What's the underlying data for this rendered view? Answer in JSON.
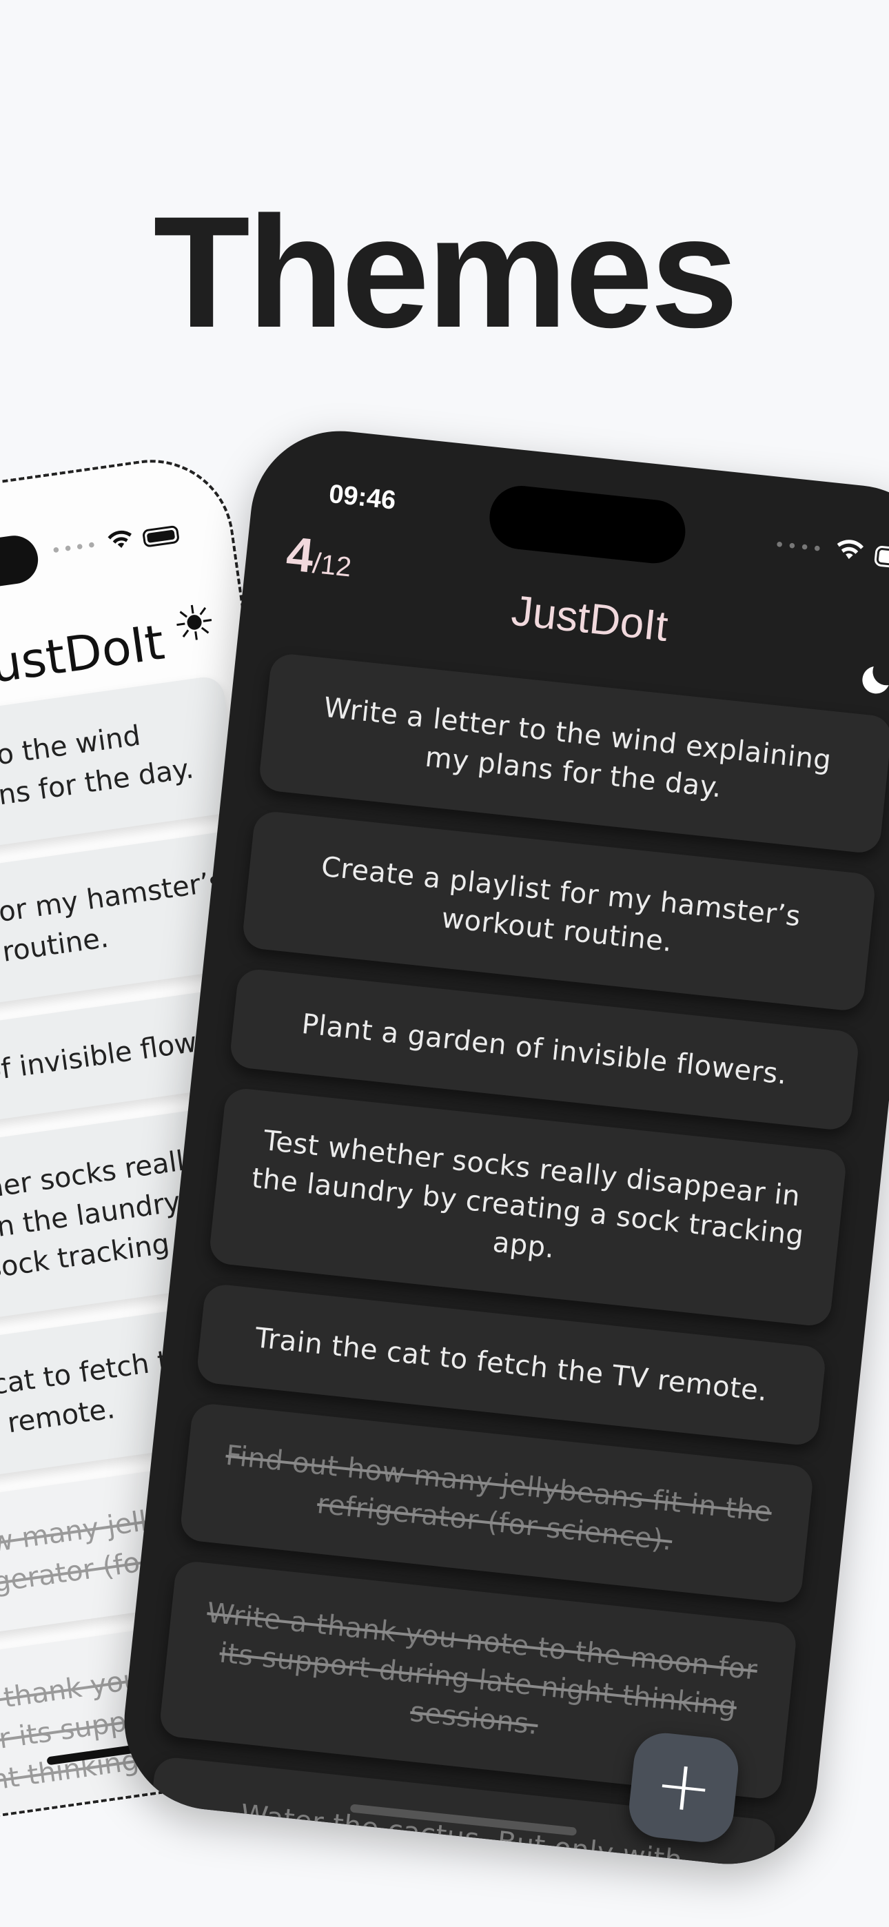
{
  "headline": "Themes",
  "light_phone": {
    "title": "JustDoIt",
    "theme_icon": "sun-icon",
    "tasks": [
      {
        "text": "Write a letter to the wind explaining my plans for the day.",
        "done": false
      },
      {
        "text": "Create a playlist for my hamster’s workout routine.",
        "done": false
      },
      {
        "text": "Plant a garden of invisible flowers.",
        "done": false
      },
      {
        "text": "Test whether socks really disappear in the laundry by creating a sock tracking app.",
        "done": false
      },
      {
        "text": "Train the cat to fetch the TV remote.",
        "done": false
      },
      {
        "text": "Find out how many jellybeans fit in the refrigerator (for science).",
        "done": true
      },
      {
        "text": "Write a thank you note to the moon for its support during late night thinking sessions.",
        "done": true
      }
    ]
  },
  "dark_phone": {
    "status_time": "09:46",
    "counter": {
      "done": "4",
      "separator": "/",
      "total": "12"
    },
    "title": "JustDoIt",
    "theme_icon": "moon-icon",
    "tasks": [
      {
        "text": "Write a letter to the wind explaining my plans for the day.",
        "done": false
      },
      {
        "text": "Create a playlist for my hamster’s workout routine.",
        "done": false
      },
      {
        "text": "Plant a garden of invisible flowers.",
        "done": false
      },
      {
        "text": "Test whether socks really disappear in the laundry by creating a sock tracking app.",
        "done": false
      },
      {
        "text": "Train the cat to fetch the TV remote.",
        "done": false
      },
      {
        "text": "Find out how many jellybeans fit in the refrigerator (for science).",
        "done": true
      },
      {
        "text": "Write a thank you note to the moon for its support during late night thinking sessions.",
        "done": true
      },
      {
        "text": "Water the cactus. But only with",
        "done": false
      }
    ],
    "add_button_label": "+"
  }
}
